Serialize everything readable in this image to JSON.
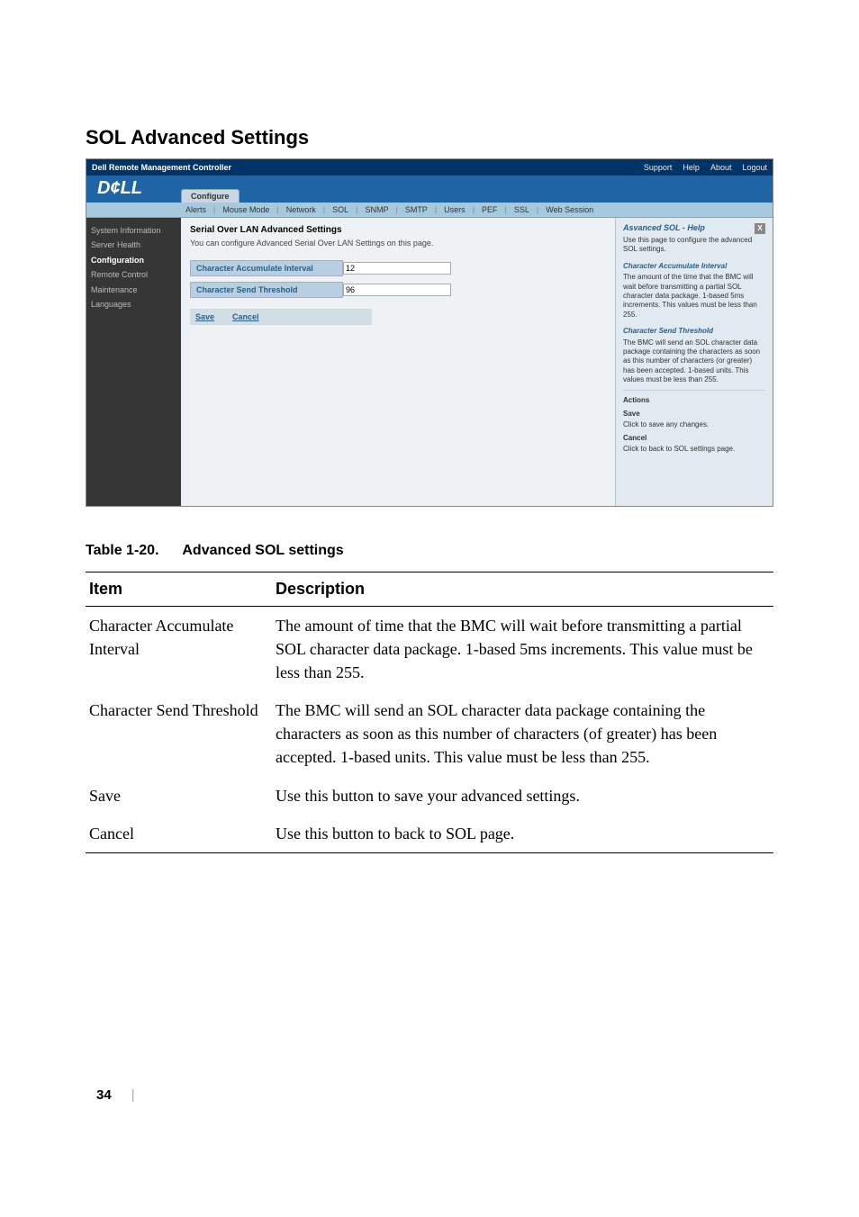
{
  "heading": "SOL Advanced Settings",
  "shot": {
    "window_title": "Dell Remote Management Controller",
    "top_links": [
      "Support",
      "Help",
      "About",
      "Logout"
    ],
    "brand_logo_text": "D¢LL",
    "main_tab": "Configure",
    "subtabs": [
      "Alerts",
      "Mouse Mode",
      "Network",
      "SOL",
      "SNMP",
      "SMTP",
      "Users",
      "PEF",
      "SSL",
      "Web Session"
    ],
    "sidebar": {
      "items": [
        {
          "label": "System Information"
        },
        {
          "label": "Server Health"
        },
        {
          "label": "Configuration",
          "active": true
        },
        {
          "label": "Remote Control"
        },
        {
          "label": "Maintenance"
        },
        {
          "label": "Languages"
        }
      ]
    },
    "main": {
      "title": "Serial Over LAN Advanced Settings",
      "desc": "You can configure Advanced Serial Over LAN Settings on this page.",
      "fields": [
        {
          "label": "Character Accumulate Interval",
          "value": "12"
        },
        {
          "label": "Character Send Threshold",
          "value": "96"
        }
      ],
      "save_label": "Save",
      "cancel_label": "Cancel"
    },
    "help": {
      "title": "Asvanced SOL - Help",
      "intro": "Use this page to configure the advanced SOL settings.",
      "sec1_title": "Character Accumulate Interval",
      "sec1_text": "The amount of the time that the BMC will wait before transmitting a partial SOL character data package. 1-based 5ms increments. This values must be less than 255.",
      "sec2_title": "Character Send Threshold",
      "sec2_text": "The BMC will send an SOL character data package containing the characters as soon as this number of characters (or greater) has been accepted. 1-based units. This values must be less than 255.",
      "actions_header": "Actions",
      "save_title": "Save",
      "save_text": "Click to save any changes.",
      "cancel_title": "Cancel",
      "cancel_text": "Click to back to SOL settings page."
    }
  },
  "table": {
    "caption_number": "Table 1-20.",
    "caption_title": "Advanced SOL settings",
    "headers": {
      "item": "Item",
      "desc": "Description"
    },
    "rows": [
      {
        "item": "Character Accumulate Interval",
        "desc": "The amount of time that the BMC will wait before transmitting a partial SOL character data package. 1-based 5ms increments. This value must be less than 255."
      },
      {
        "item": "Character Send Threshold",
        "desc": "The BMC will send an SOL character data package containing the characters as soon as this number of characters (of greater) has been accepted. 1-based units. This value must be less than 255."
      },
      {
        "item": "Save",
        "desc": "Use this button to save your advanced settings."
      },
      {
        "item": "Cancel",
        "desc": "Use this button to back to SOL page."
      }
    ]
  },
  "page_number": "34"
}
